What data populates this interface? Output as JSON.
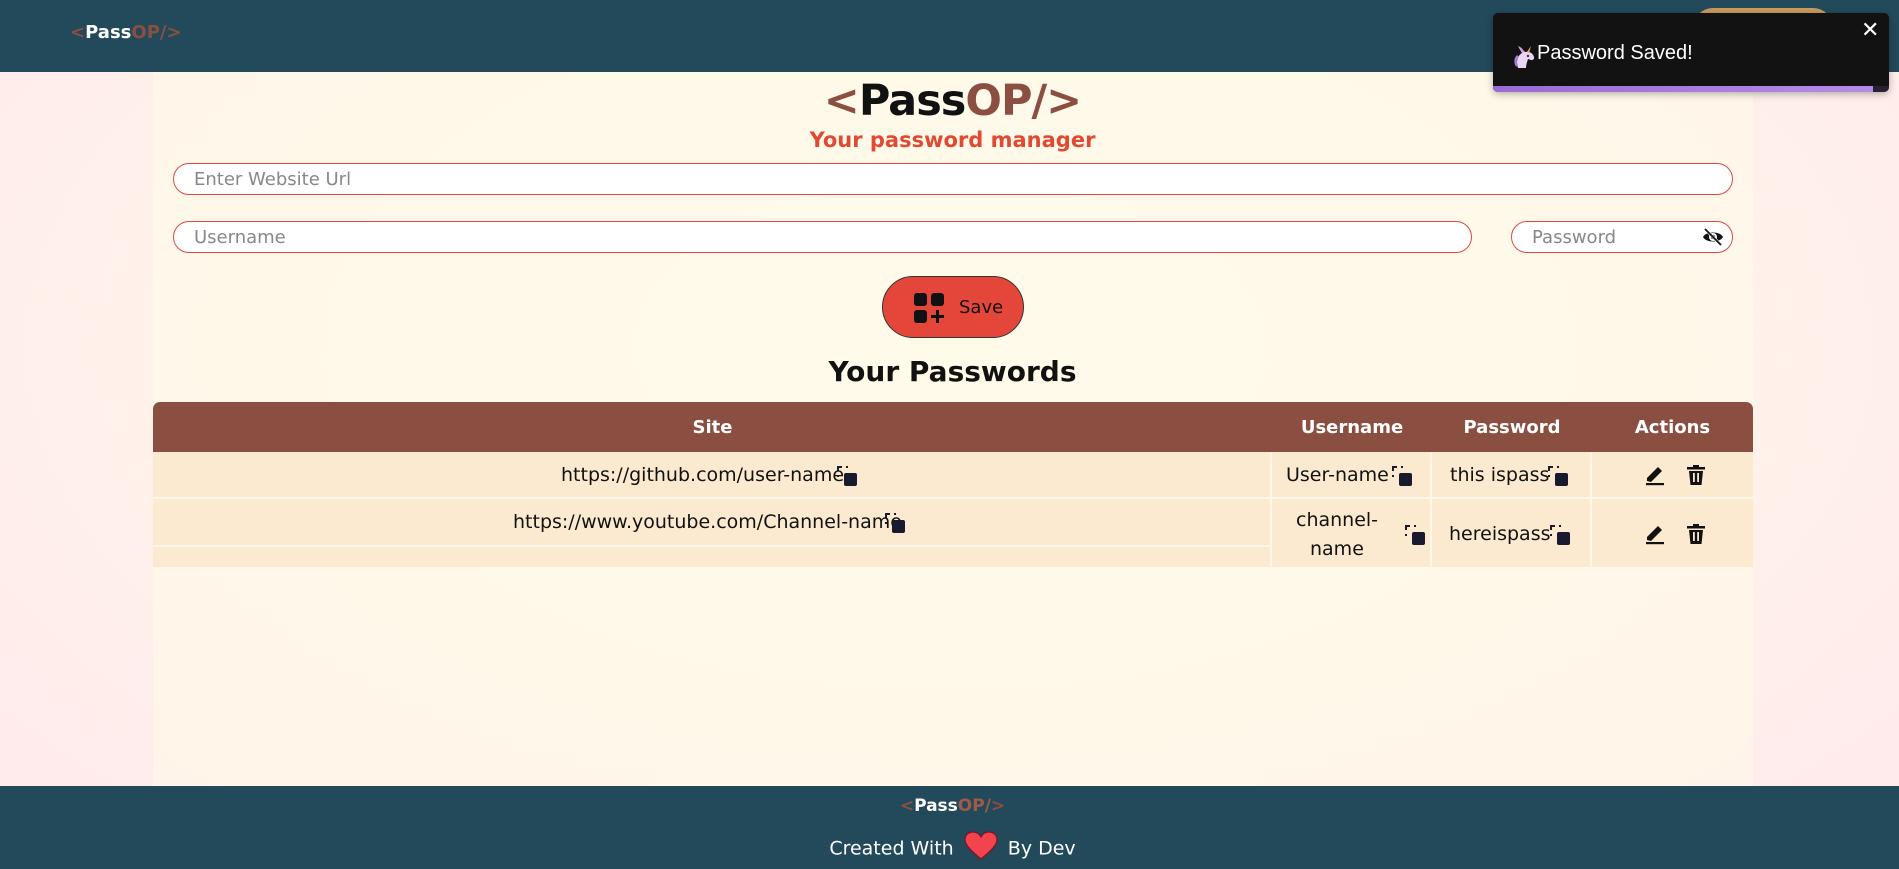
{
  "navbar": {
    "logo": {
      "open": "<",
      "pass": "Pass",
      "op": "OP/",
      "close": ">"
    }
  },
  "toast": {
    "icon": "unicorn-icon",
    "message": "Password Saved!",
    "close": "✕",
    "progress": 0.96
  },
  "brand": {
    "open": "<",
    "pass": "Pass",
    "op": "OP/",
    "close": ">",
    "subtitle": "Your password manager"
  },
  "form": {
    "url_placeholder": "Enter Website Url",
    "username_placeholder": "Username",
    "password_placeholder": "Password",
    "eye_icon": "eye-slash-icon",
    "save_label": "Save",
    "save_icon": "add-grid-icon"
  },
  "passwords": {
    "title": "Your Passwords",
    "headers": {
      "site": "Site",
      "username": "Username",
      "password": "Password",
      "actions": "Actions"
    },
    "rows": [
      {
        "site": "https://github.com/user-name",
        "username": "User-name",
        "password": "this ispass"
      },
      {
        "site": "https://www.youtube.com/Channel-name",
        "username_line1": "channel-",
        "username_line2": "name",
        "password": "hereispass"
      }
    ],
    "icons": {
      "copy": "copy-icon",
      "edit": "edit-icon",
      "delete": "delete-icon"
    }
  },
  "footer": {
    "logo": {
      "open": "<",
      "pass": "Pass",
      "op": "OP/",
      "close": ">"
    },
    "created": "Created With",
    "by": "By Dev",
    "heart_icon": "heart-icon"
  },
  "colors": {
    "navbar": "#234a5b",
    "brown": "#8b4f41",
    "accent_red": "#e4473a",
    "row_bg": "#fbead0"
  }
}
